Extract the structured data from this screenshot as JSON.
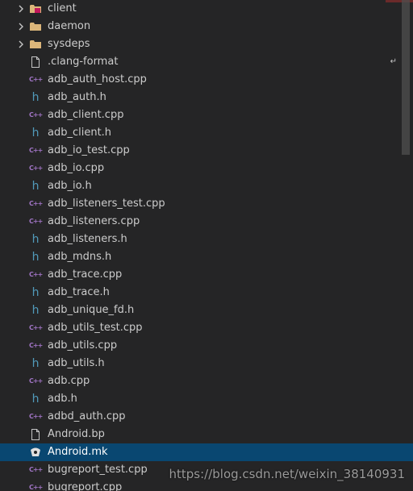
{
  "colors": {
    "background": "#252526",
    "selection": "#094771",
    "text": "#cccccc",
    "cpp_icon": "#a074c4",
    "h_icon": "#519aba",
    "folder_icon": "#dcb67a"
  },
  "explorer": {
    "items": [
      {
        "label": "client",
        "type": "folder",
        "icon": "folder-special-icon"
      },
      {
        "label": "daemon",
        "type": "folder",
        "icon": "folder-icon"
      },
      {
        "label": "sysdeps",
        "type": "folder",
        "icon": "folder-icon"
      },
      {
        "label": ".clang-format",
        "type": "file",
        "icon": "file-icon"
      },
      {
        "label": "adb_auth_host.cpp",
        "type": "cpp",
        "icon": "cpp-icon"
      },
      {
        "label": "adb_auth.h",
        "type": "h",
        "icon": "h-icon"
      },
      {
        "label": "adb_client.cpp",
        "type": "cpp",
        "icon": "cpp-icon"
      },
      {
        "label": "adb_client.h",
        "type": "h",
        "icon": "h-icon"
      },
      {
        "label": "adb_io_test.cpp",
        "type": "cpp",
        "icon": "cpp-icon"
      },
      {
        "label": "adb_io.cpp",
        "type": "cpp",
        "icon": "cpp-icon"
      },
      {
        "label": "adb_io.h",
        "type": "h",
        "icon": "h-icon"
      },
      {
        "label": "adb_listeners_test.cpp",
        "type": "cpp",
        "icon": "cpp-icon"
      },
      {
        "label": "adb_listeners.cpp",
        "type": "cpp",
        "icon": "cpp-icon"
      },
      {
        "label": "adb_listeners.h",
        "type": "h",
        "icon": "h-icon"
      },
      {
        "label": "adb_mdns.h",
        "type": "h",
        "icon": "h-icon"
      },
      {
        "label": "adb_trace.cpp",
        "type": "cpp",
        "icon": "cpp-icon"
      },
      {
        "label": "adb_trace.h",
        "type": "h",
        "icon": "h-icon"
      },
      {
        "label": "adb_unique_fd.h",
        "type": "h",
        "icon": "h-icon"
      },
      {
        "label": "adb_utils_test.cpp",
        "type": "cpp",
        "icon": "cpp-icon"
      },
      {
        "label": "adb_utils.cpp",
        "type": "cpp",
        "icon": "cpp-icon"
      },
      {
        "label": "adb_utils.h",
        "type": "h",
        "icon": "h-icon"
      },
      {
        "label": "adb.cpp",
        "type": "cpp",
        "icon": "cpp-icon"
      },
      {
        "label": "adb.h",
        "type": "h",
        "icon": "h-icon"
      },
      {
        "label": "adbd_auth.cpp",
        "type": "cpp",
        "icon": "cpp-icon"
      },
      {
        "label": "Android.bp",
        "type": "file",
        "icon": "file-icon"
      },
      {
        "label": "Android.mk",
        "type": "mk",
        "icon": "makefile-icon",
        "selected": true
      },
      {
        "label": "bugreport_test.cpp",
        "type": "cpp",
        "icon": "cpp-icon"
      },
      {
        "label": "bugreport.cpp",
        "type": "cpp",
        "icon": "cpp-icon"
      }
    ],
    "folder_chevron": "›",
    "overflow_marker": "↵"
  },
  "watermark": "https://blog.csdn.net/weixin_38140931"
}
